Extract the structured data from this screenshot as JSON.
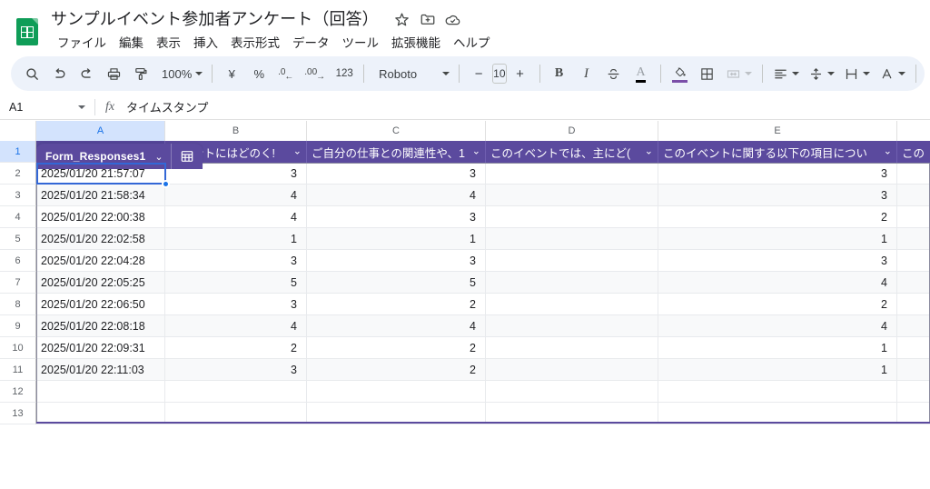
{
  "app": {
    "logo_name": "google-sheets-logo",
    "document_title": "サンプルイベント参加者アンケート（回答）"
  },
  "title_icons": [
    {
      "name": "star-icon",
      "label": "スターを付ける"
    },
    {
      "name": "move-to-folder-icon",
      "label": "移動"
    },
    {
      "name": "cloud-saved-icon",
      "label": "ドライブに保存しました"
    }
  ],
  "menu": {
    "items": [
      {
        "label": "ファイル"
      },
      {
        "label": "編集"
      },
      {
        "label": "表示"
      },
      {
        "label": "挿入"
      },
      {
        "label": "表示形式"
      },
      {
        "label": "データ"
      },
      {
        "label": "ツール"
      },
      {
        "label": "拡張機能"
      },
      {
        "label": "ヘルプ"
      }
    ]
  },
  "toolbar": {
    "search_icon": "search-icon",
    "undo_icon": "undo-icon",
    "redo_icon": "redo-icon",
    "print_icon": "print-icon",
    "paint_format_icon": "paint-format-icon",
    "zoom_value": "100%",
    "currency_label": "¥",
    "percent_label": "%",
    "decrease_decimal_label": ".0",
    "increase_decimal_label": ".00",
    "more_formats_label": "123",
    "font_name": "Roboto",
    "font_size": "10",
    "decrease_font_label": "−",
    "increase_font_label": "+",
    "bold_label": "B",
    "italic_label": "I",
    "strikethrough_icon": "strikethrough-icon",
    "text_color_label": "A",
    "fill_color_icon": "fill-color-icon",
    "fill_color_swatch": "#7B4FA8",
    "borders_icon": "borders-icon",
    "merge_cells_icon": "merge-cells-icon",
    "horizontal_align_icon": "horizontal-align-icon",
    "vertical_align_icon": "vertical-align-icon",
    "text_wrap_icon": "text-wrap-icon",
    "text_rotation_icon": "text-rotation-icon",
    "overflow_icon": "more-options-icon"
  },
  "formula_bar": {
    "name_box_value": "A1",
    "fx_label": "fx",
    "formula_value": "タイムスタンプ"
  },
  "grid": {
    "column_headers": [
      "A",
      "B",
      "C",
      "D",
      "E"
    ],
    "selected_column": "A",
    "selected_row": "1",
    "row_numbers": [
      "1",
      "2",
      "3",
      "4",
      "5",
      "6",
      "7",
      "8",
      "9",
      "10",
      "11",
      "12"
    ],
    "table_chip": {
      "name": "Form_Responses1",
      "caret": "⌄",
      "icon_name": "table-icon"
    },
    "header_row": [
      {
        "label": "タイムスタンプ",
        "chevron": "⌄"
      },
      {
        "label": "イベントにはどのく!",
        "chevron": "⌄"
      },
      {
        "label": "ご自分の仕事との関連性や、1",
        "chevron": "⌄"
      },
      {
        "label": "このイベントでは、主にど(",
        "chevron": "⌄"
      },
      {
        "label": "このイベントに関する以下の項目につい",
        "chevron": "⌄"
      },
      {
        "label": "この",
        "chevron": ""
      }
    ],
    "rows": [
      {
        "n": "2",
        "a": "2025/01/20 21:57:07",
        "b": "3",
        "c": "3",
        "d": "",
        "e": "3"
      },
      {
        "n": "3",
        "a": "2025/01/20 21:58:34",
        "b": "4",
        "c": "4",
        "d": "",
        "e": "3"
      },
      {
        "n": "4",
        "a": "2025/01/20 22:00:38",
        "b": "4",
        "c": "3",
        "d": "",
        "e": "2"
      },
      {
        "n": "5",
        "a": "2025/01/20 22:02:58",
        "b": "1",
        "c": "1",
        "d": "",
        "e": "1"
      },
      {
        "n": "6",
        "a": "2025/01/20 22:04:28",
        "b": "3",
        "c": "3",
        "d": "",
        "e": "3"
      },
      {
        "n": "7",
        "a": "2025/01/20 22:05:25",
        "b": "5",
        "c": "5",
        "d": "",
        "e": "4"
      },
      {
        "n": "8",
        "a": "2025/01/20 22:06:50",
        "b": "3",
        "c": "2",
        "d": "",
        "e": "2"
      },
      {
        "n": "9",
        "a": "2025/01/20 22:08:18",
        "b": "4",
        "c": "4",
        "d": "",
        "e": "4"
      },
      {
        "n": "10",
        "a": "2025/01/20 22:09:31",
        "b": "2",
        "c": "2",
        "d": "",
        "e": "1"
      },
      {
        "n": "11",
        "a": "2025/01/20 22:11:03",
        "b": "3",
        "c": "2",
        "d": "",
        "e": "1"
      },
      {
        "n": "12",
        "a": "",
        "b": "",
        "c": "",
        "d": "",
        "e": ""
      }
    ]
  },
  "colors": {
    "table_header_purple": "#5B4A9E",
    "selection_blue": "#3367D6",
    "header_select_blue": "#D3E3FD",
    "toolbar_bg": "#EDF2FA",
    "sheets_green": "#0F9D58"
  }
}
